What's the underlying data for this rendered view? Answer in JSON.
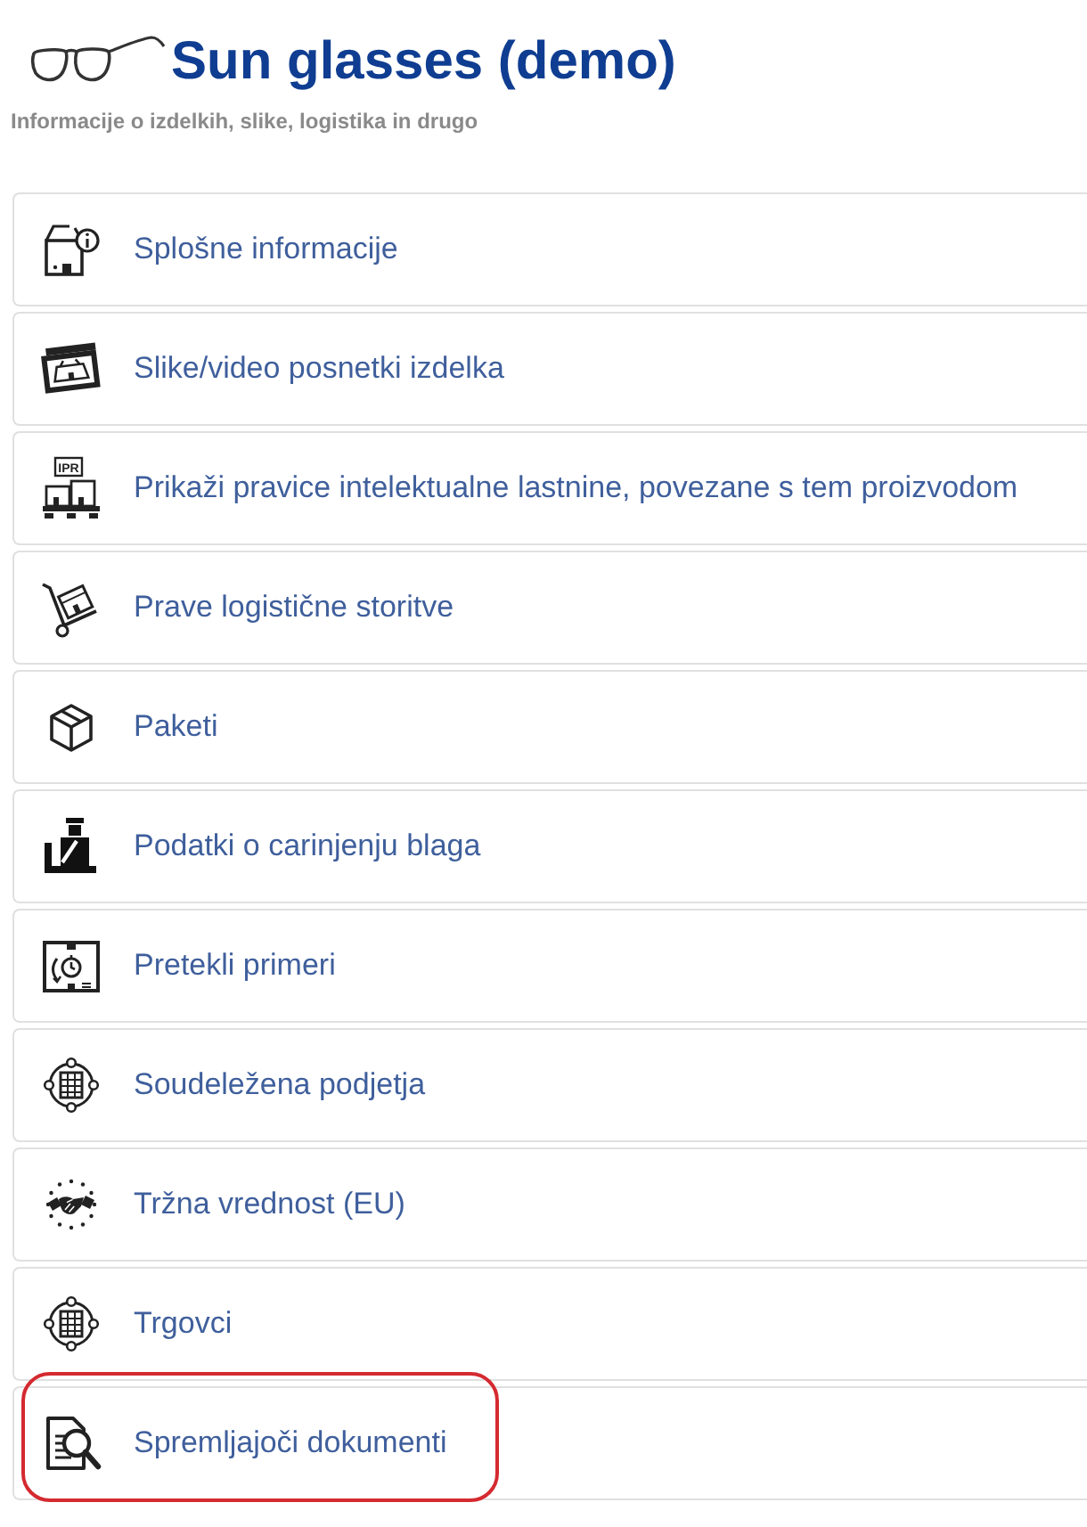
{
  "header": {
    "title": "Sun glasses (demo)",
    "subtitle": "Informacije o izdelkih, slike, logistika in drugo"
  },
  "items": [
    {
      "label": "Splošne informacije",
      "highlighted": false
    },
    {
      "label": "Slike/video posnetki izdelka",
      "highlighted": false
    },
    {
      "label": "Prikaži pravice intelektualne lastnine, povezane s tem proizvodom",
      "icon_label": "IPR",
      "highlighted": false
    },
    {
      "label": "Prave logistične storitve",
      "highlighted": false
    },
    {
      "label": "Paketi",
      "highlighted": false
    },
    {
      "label": "Podatki o carinjenju blaga",
      "highlighted": false
    },
    {
      "label": "Pretekli primeri",
      "highlighted": false
    },
    {
      "label": "Soudeležena podjetja",
      "highlighted": false
    },
    {
      "label": "Tržna vrednost (EU)",
      "highlighted": false
    },
    {
      "label": "Trgovci",
      "highlighted": false
    },
    {
      "label": "Spremljajoči dokumenti",
      "highlighted": true
    }
  ]
}
